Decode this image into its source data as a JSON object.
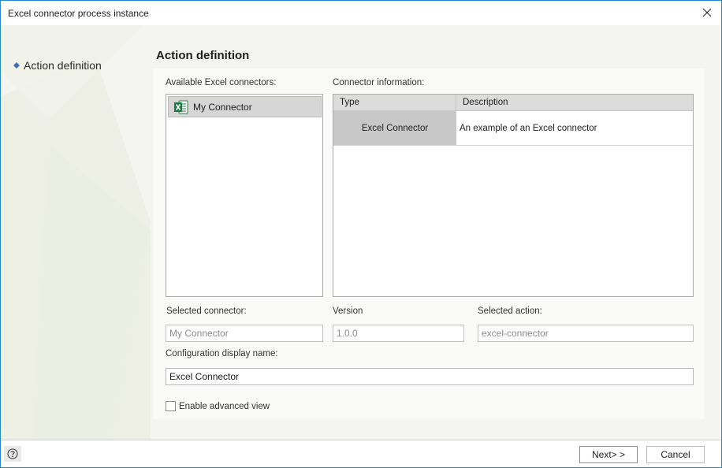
{
  "window": {
    "title": "Excel connector process instance",
    "accent_color": "#1d8ad6"
  },
  "nav": {
    "steps": [
      {
        "label": "Action definition",
        "icon": "step-bullet-icon",
        "active": true
      }
    ]
  },
  "page": {
    "title": "Action definition"
  },
  "connectors": {
    "label": "Available Excel connectors:",
    "items": [
      {
        "name": "My Connector",
        "icon": "excel-icon",
        "selected": true
      }
    ]
  },
  "connector_info": {
    "label": "Connector information:",
    "columns": [
      "Type",
      "Description"
    ],
    "rows": [
      {
        "type": "Excel Connector",
        "description": "An example of an Excel connector"
      }
    ]
  },
  "fields": {
    "selected_connector": {
      "label": "Selected connector:",
      "value": "My Connector"
    },
    "version": {
      "label": "Version",
      "value": "1.0.0"
    },
    "selected_action": {
      "label": "Selected action:",
      "value": "excel-connector"
    },
    "display_name": {
      "label": "Configuration display name:",
      "value": "Excel Connector"
    }
  },
  "advanced_view": {
    "label": "Enable advanced view",
    "checked": false
  },
  "footer": {
    "help_icon": "help-icon",
    "next_label": "Next> >",
    "cancel_label": "Cancel"
  }
}
